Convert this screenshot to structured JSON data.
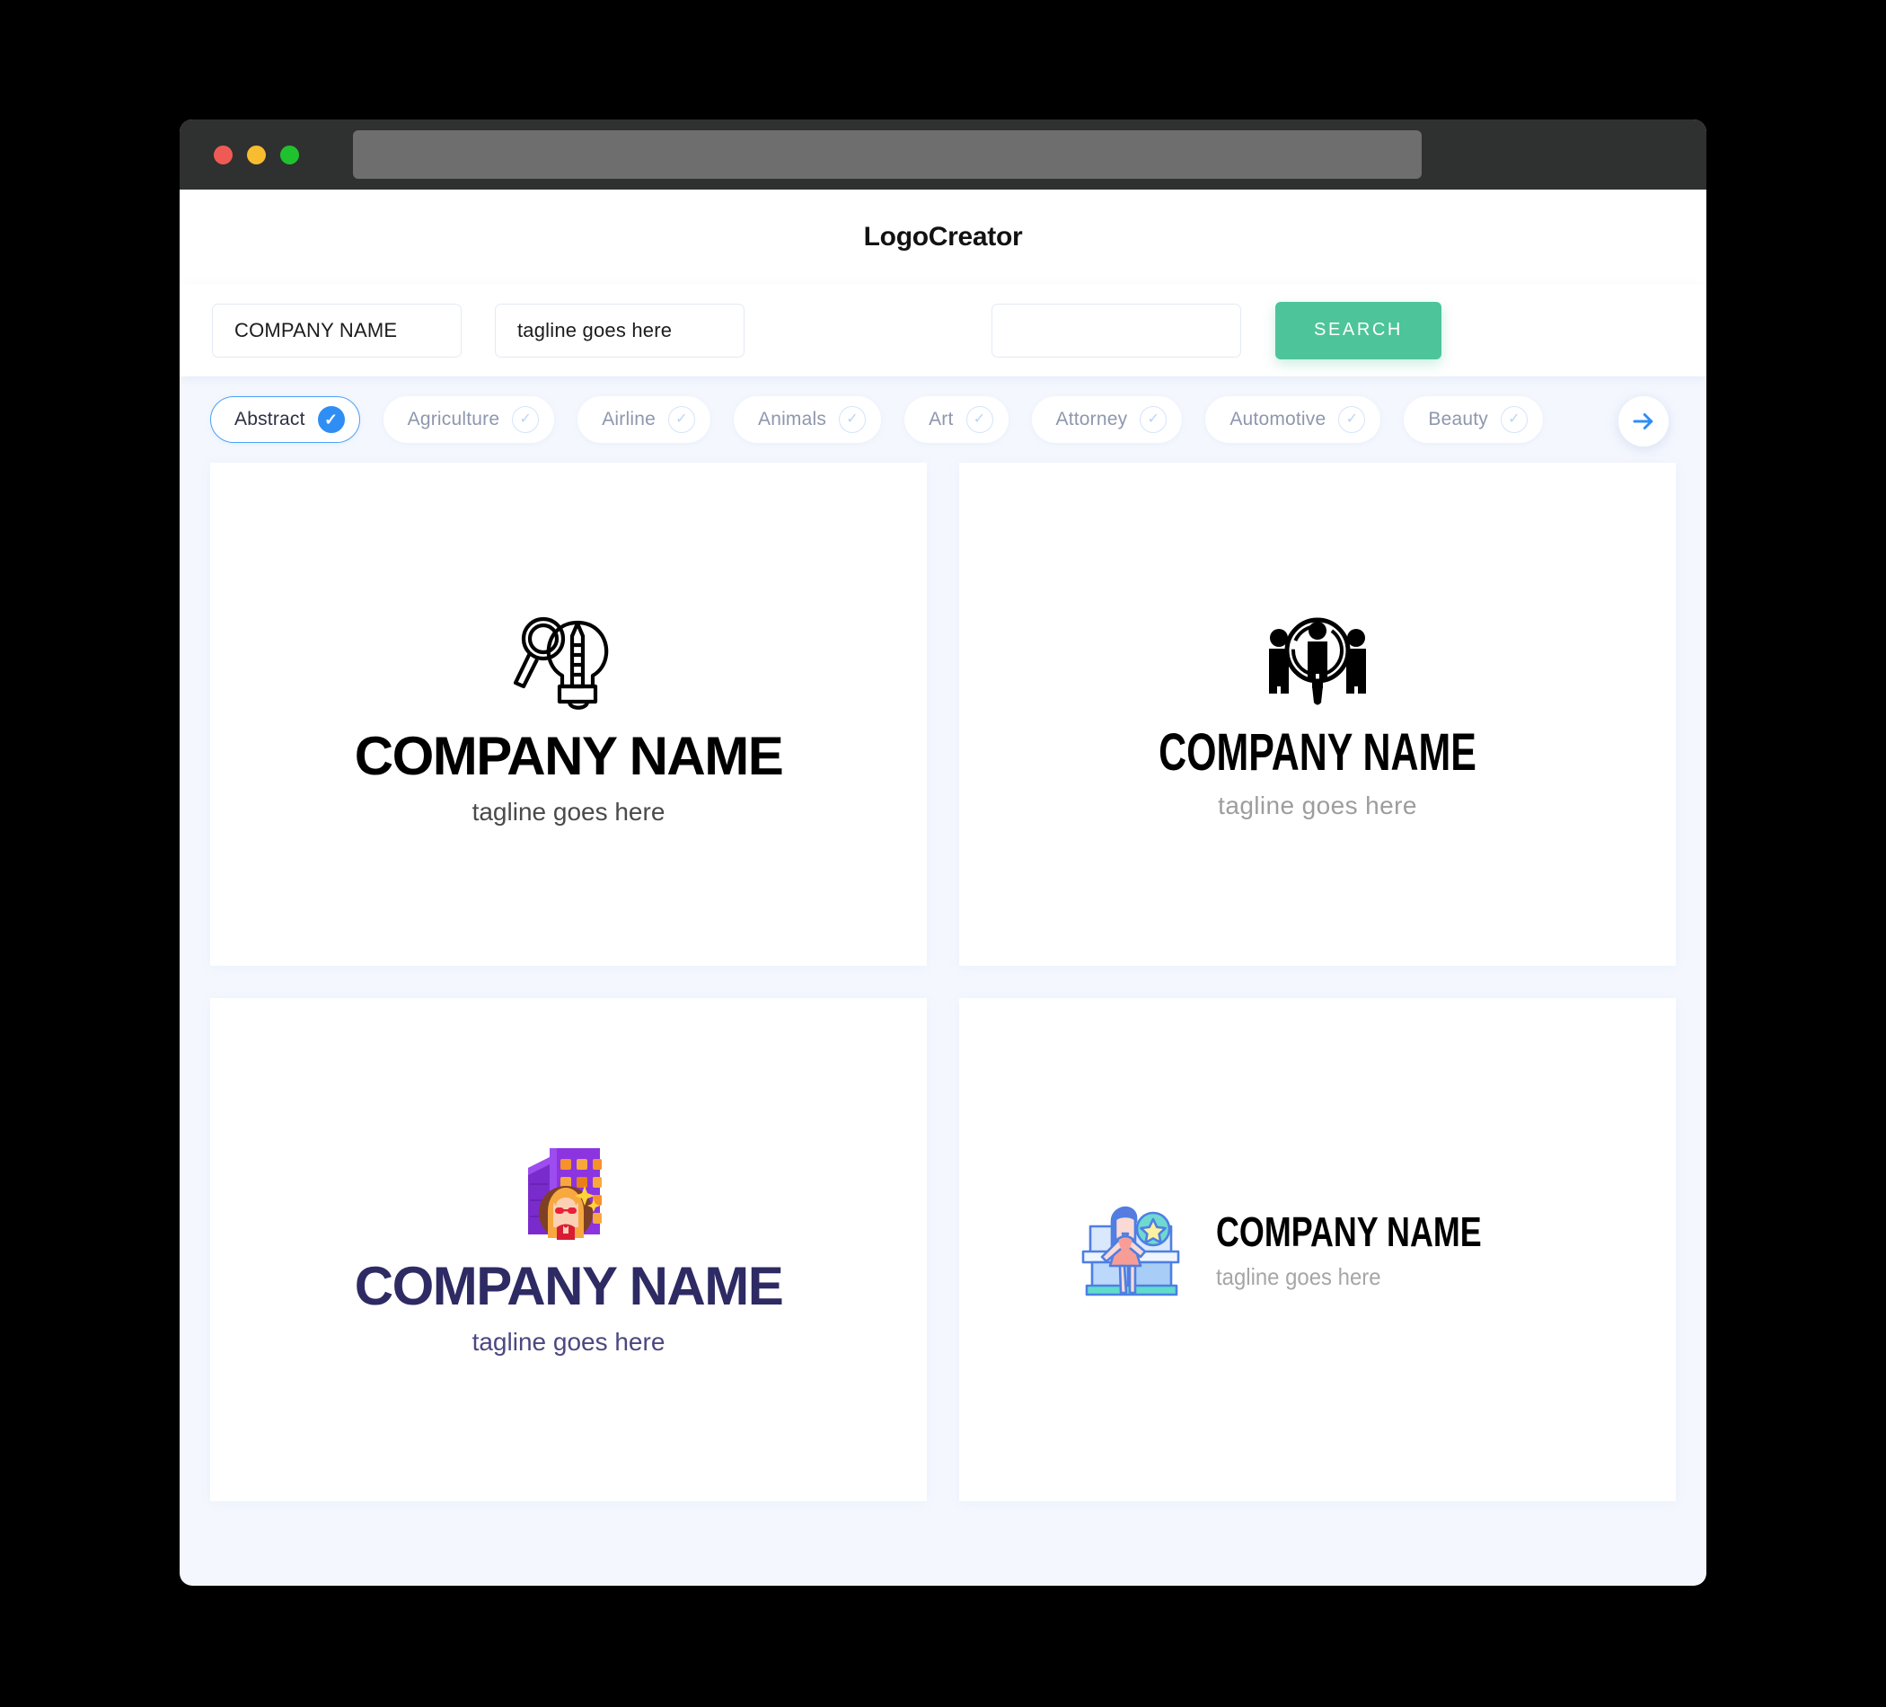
{
  "window": {
    "traffic_lights": [
      "close-red",
      "minimize-yellow",
      "maximize-green"
    ],
    "url_value": ""
  },
  "header": {
    "app_title": "LogoCreator"
  },
  "search": {
    "company_value": "COMPANY NAME",
    "company_placeholder": "COMPANY NAME",
    "tagline_value": "tagline goes here",
    "tagline_placeholder": "tagline goes here",
    "keyword_value": "",
    "keyword_placeholder": "",
    "search_label": "SEARCH"
  },
  "categories": {
    "next_icon": "arrow-right-icon",
    "chips": [
      {
        "label": "Abstract",
        "selected": true,
        "icon": "check-circle-icon"
      },
      {
        "label": "Agriculture",
        "selected": false,
        "icon": "check-circle-icon"
      },
      {
        "label": "Airline",
        "selected": false,
        "icon": "check-circle-icon"
      },
      {
        "label": "Animals",
        "selected": false,
        "icon": "check-circle-icon"
      },
      {
        "label": "Art",
        "selected": false,
        "icon": "check-circle-icon"
      },
      {
        "label": "Attorney",
        "selected": false,
        "icon": "check-circle-icon"
      },
      {
        "label": "Automotive",
        "selected": false,
        "icon": "check-circle-icon"
      },
      {
        "label": "Beauty",
        "selected": false,
        "icon": "check-circle-icon"
      }
    ]
  },
  "results": {
    "logos": [
      {
        "icon": "lightbulb-magnifier-pencil-icon",
        "name": "COMPANY NAME",
        "tagline": "tagline goes here",
        "name_color": "#000000",
        "tagline_color": "#4a4a4a",
        "layout": "stacked"
      },
      {
        "icon": "people-magnifier-icon",
        "name": "COMPANY NAME",
        "tagline": "tagline goes here",
        "name_color": "#000000",
        "tagline_color": "#9d9d9d",
        "layout": "stacked"
      },
      {
        "icon": "building-woman-avatar-icon",
        "name": "COMPANY NAME",
        "tagline": "tagline goes here",
        "name_color": "#2e2a63",
        "tagline_color": "#4a4880",
        "layout": "stacked"
      },
      {
        "icon": "boutique-storefront-woman-icon",
        "name": "COMPANY NAME",
        "tagline": "tagline goes here",
        "name_color": "#000000",
        "tagline_color": "#a6a6a6",
        "layout": "horizontal"
      }
    ]
  },
  "colors": {
    "page_bg": "#f4f7fe",
    "accent_green": "#4dc49a",
    "accent_blue": "#2f8ef4",
    "chrome_dark": "#2f3030"
  }
}
